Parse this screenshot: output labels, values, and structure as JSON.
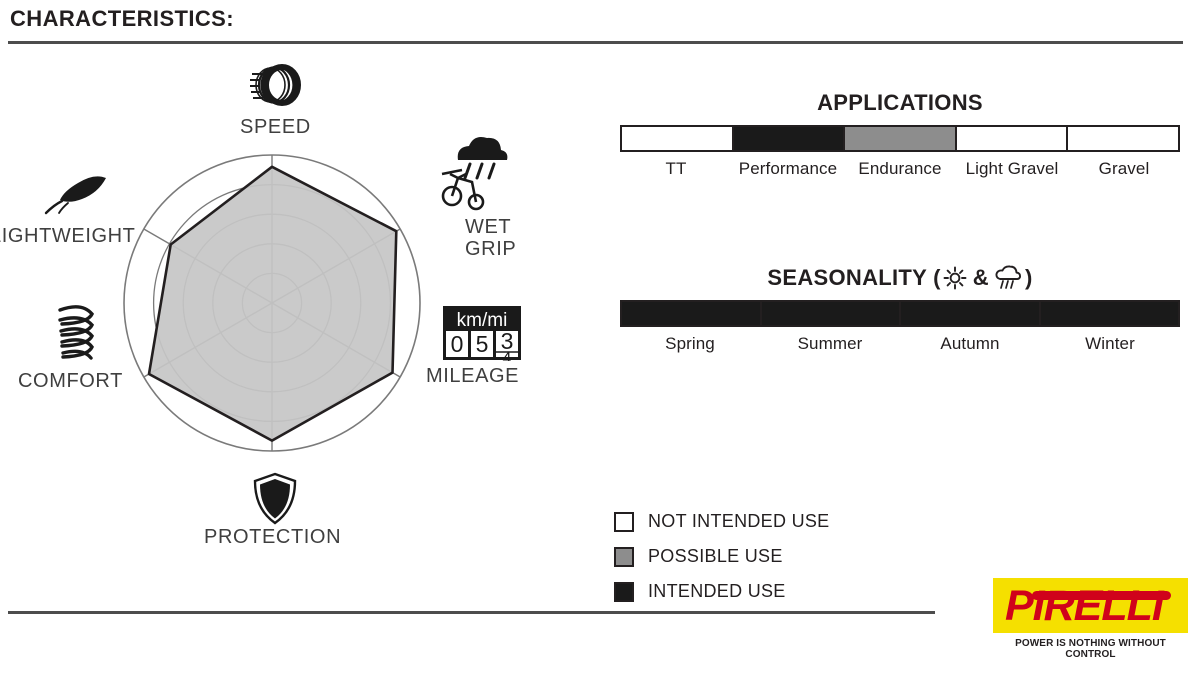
{
  "header": {
    "title": "CHARACTERISTICS:"
  },
  "radar": {
    "axes": [
      {
        "label": "SPEED",
        "icon": "tire-wheel-icon",
        "value": 4.6
      },
      {
        "label": "WET\nGRIP",
        "icon": "bike-rain-cloud-icon",
        "value": 4.85
      },
      {
        "label": "MILEAGE",
        "icon": "odometer-icon",
        "value": 4.7
      },
      {
        "label": "PROTECTION",
        "icon": "shield-icon",
        "value": 4.65
      },
      {
        "label": "COMFORT",
        "icon": "coil-spring-icon",
        "value": 4.8
      },
      {
        "label": "LIGHTWEIGHT",
        "icon": "feather-icon",
        "value": 3.95
      }
    ],
    "odometer": {
      "unit": "km/mi",
      "digits": [
        "0",
        "5",
        "3"
      ]
    },
    "rings": 5,
    "max": 5,
    "fill_color": "#c6c6c6",
    "outline_color": "#231f20",
    "grid_color": "#7a7a7a"
  },
  "chart_data": {
    "type": "radar",
    "title": "CHARACTERISTICS:",
    "categories": [
      "SPEED",
      "WET GRIP",
      "MILEAGE",
      "PROTECTION",
      "COMFORT",
      "LIGHTWEIGHT"
    ],
    "values": [
      4.6,
      4.85,
      4.7,
      4.65,
      4.8,
      3.95
    ],
    "range": [
      0,
      5
    ],
    "rings": 5,
    "grid": true,
    "legend": false,
    "secondary_charts": [
      {
        "type": "bar",
        "title": "APPLICATIONS",
        "categories": [
          "TT",
          "Performance",
          "Endurance",
          "Light Gravel",
          "Gravel"
        ],
        "values": [
          "not_intended",
          "intended",
          "possible",
          "not_intended",
          "not_intended"
        ]
      },
      {
        "type": "bar",
        "title": "SEASONALITY",
        "categories": [
          "Spring",
          "Summer",
          "Autumn",
          "Winter"
        ],
        "values": [
          "intended",
          "intended",
          "intended",
          "intended"
        ]
      }
    ]
  },
  "applications": {
    "title": "APPLICATIONS",
    "segments": [
      {
        "label": "TT",
        "use": "not_intended"
      },
      {
        "label": "Performance",
        "use": "intended"
      },
      {
        "label": "Endurance",
        "use": "possible"
      },
      {
        "label": "Light Gravel",
        "use": "not_intended"
      },
      {
        "label": "Gravel",
        "use": "not_intended"
      }
    ]
  },
  "seasonality": {
    "title_prefix": "SEASONALITY (",
    "title_amp": "&",
    "title_suffix": ")",
    "sun_icon": "sun-icon",
    "rain_icon": "rain-cloud-icon",
    "segments": [
      {
        "label": "Spring",
        "use": "intended"
      },
      {
        "label": "Summer",
        "use": "intended"
      },
      {
        "label": "Autumn",
        "use": "intended"
      },
      {
        "label": "Winter",
        "use": "intended"
      }
    ]
  },
  "legend": {
    "items": [
      {
        "label": "NOT INTENDED USE",
        "use": "not_intended"
      },
      {
        "label": "POSSIBLE USE",
        "use": "possible"
      },
      {
        "label": "INTENDED USE",
        "use": "intended"
      }
    ]
  },
  "brand": {
    "name": "PIRELLI",
    "tagline": "POWER IS NOTHING WITHOUT CONTROL",
    "plate_color": "#f5e000",
    "wordmark_color": "#d0021b"
  },
  "colors": {
    "intended": "#1a1a1a",
    "possible": "#8d8d8d",
    "not_intended": "#ffffff",
    "rule": "#4d4d4d"
  }
}
